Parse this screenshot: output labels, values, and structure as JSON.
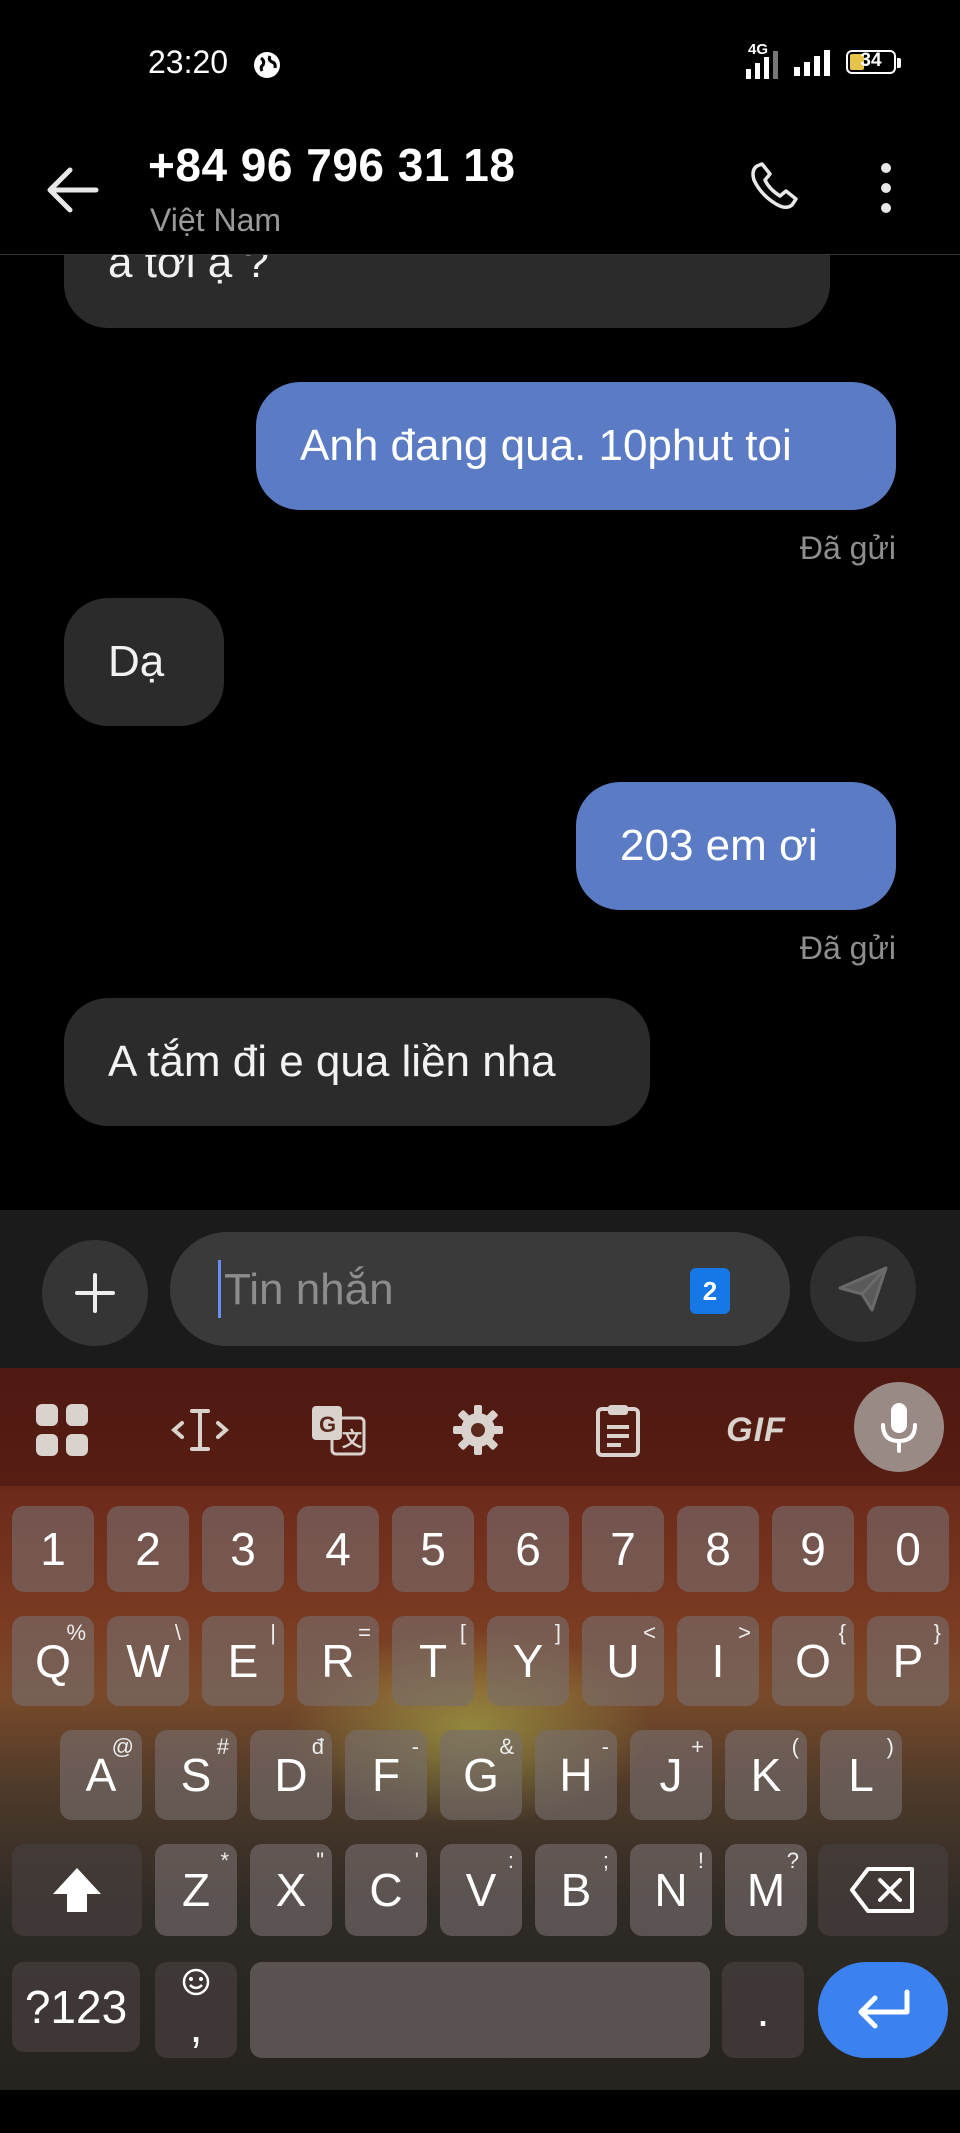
{
  "status_bar": {
    "time": "23:20",
    "network": "4G",
    "battery": "34"
  },
  "header": {
    "contact_number": "+84 96 796 31 18",
    "contact_country": "Việt Nam"
  },
  "messages": [
    {
      "direction": "in",
      "text": "a tới ạ ?"
    },
    {
      "direction": "out",
      "text": "Anh đang qua. 10phut toi",
      "status": "Đã gửi"
    },
    {
      "direction": "in",
      "text": "Dạ"
    },
    {
      "direction": "out",
      "text": "203 em ơi",
      "status": "Đã gửi"
    },
    {
      "direction": "in",
      "text": "A tắm đi e qua liền nha"
    }
  ],
  "compose": {
    "placeholder": "Tin nhắn",
    "sim_slot": "2"
  },
  "keyboard": {
    "toolbar": {
      "gif_label": "GIF"
    },
    "number_row": [
      "1",
      "2",
      "3",
      "4",
      "5",
      "6",
      "7",
      "8",
      "9",
      "0"
    ],
    "row1": [
      {
        "k": "Q",
        "h": "%"
      },
      {
        "k": "W",
        "h": "\\"
      },
      {
        "k": "E",
        "h": "|"
      },
      {
        "k": "R",
        "h": "="
      },
      {
        "k": "T",
        "h": "["
      },
      {
        "k": "Y",
        "h": "]"
      },
      {
        "k": "U",
        "h": "<"
      },
      {
        "k": "I",
        "h": ">"
      },
      {
        "k": "O",
        "h": "{"
      },
      {
        "k": "P",
        "h": "}"
      }
    ],
    "row2": [
      {
        "k": "A",
        "h": "@"
      },
      {
        "k": "S",
        "h": "#"
      },
      {
        "k": "D",
        "h": "đ"
      },
      {
        "k": "F",
        "h": "-"
      },
      {
        "k": "G",
        "h": "&"
      },
      {
        "k": "H",
        "h": "-"
      },
      {
        "k": "J",
        "h": "+"
      },
      {
        "k": "K",
        "h": "("
      },
      {
        "k": "L",
        "h": ")"
      }
    ],
    "row3": [
      {
        "k": "Z",
        "h": "*"
      },
      {
        "k": "X",
        "h": "\""
      },
      {
        "k": "C",
        "h": "'"
      },
      {
        "k": "V",
        "h": ":"
      },
      {
        "k": "B",
        "h": ";"
      },
      {
        "k": "N",
        "h": "!"
      },
      {
        "k": "M",
        "h": "?"
      }
    ],
    "symbols_label": "?123",
    "comma_label": ",",
    "period_label": "."
  },
  "colors": {
    "outgoing_bubble": "#5b7bc4",
    "incoming_bubble": "#2b2b2b",
    "enter_key": "#3b82f0",
    "sim_badge": "#1677e6"
  }
}
